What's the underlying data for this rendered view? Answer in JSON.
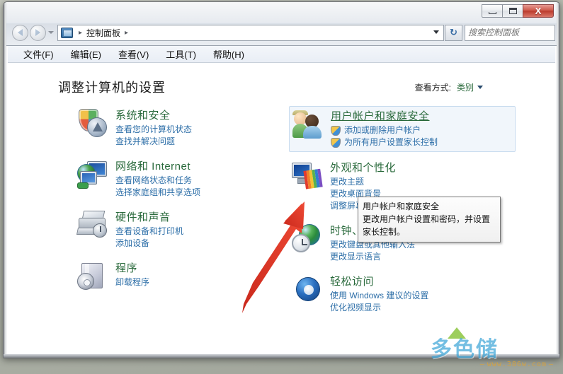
{
  "window": {
    "buttons": {
      "minimize": "—",
      "maximize": "□",
      "close": "X"
    }
  },
  "nav": {
    "back_icon": "back-arrow-icon",
    "forward_icon": "forward-arrow-icon",
    "recent_caret": "history-dropdown-icon",
    "breadcrumb_icon": "control-panel-icon",
    "breadcrumb": "控制面板",
    "breadcrumb_sep": "▸",
    "dropdown_caret": "▾",
    "refresh_label": "↻",
    "search_placeholder": "搜索控制面板"
  },
  "menubar": {
    "items": [
      {
        "label": "文件(F)"
      },
      {
        "label": "编辑(E)"
      },
      {
        "label": "查看(V)"
      },
      {
        "label": "工具(T)"
      },
      {
        "label": "帮助(H)"
      }
    ]
  },
  "page": {
    "title": "调整计算机的设置",
    "view_by_label": "查看方式:",
    "view_by_value": "类别"
  },
  "categories_left": [
    {
      "title": "系统和安全",
      "icon": "shield-gauge-icon",
      "links": [
        "查看您的计算机状态",
        "查找并解决问题"
      ]
    },
    {
      "title": "网络和 Internet",
      "icon": "network-globe-icon",
      "links": [
        "查看网络状态和任务",
        "选择家庭组和共享选项"
      ]
    },
    {
      "title": "硬件和声音",
      "icon": "printer-icon",
      "links": [
        "查看设备和打印机",
        "添加设备"
      ]
    },
    {
      "title": "程序",
      "icon": "program-box-icon",
      "links": [
        "卸载程序"
      ]
    }
  ],
  "categories_right": [
    {
      "title": "用户帐户和家庭安全",
      "icon": "users-icon",
      "selected": true,
      "links": [
        "添加或删除用户帐户",
        "为所有用户设置家长控制"
      ],
      "shielded": true
    },
    {
      "title": "外观和个性化",
      "icon": "appearance-palette-icon",
      "links": [
        "更改主题",
        "更改桌面背景",
        "调整屏幕分辨率"
      ]
    },
    {
      "title": "时钟、语言和区域",
      "icon": "clock-globe-icon",
      "links": [
        "更改键盘或其他输入法",
        "更改显示语言"
      ]
    },
    {
      "title": "轻松访问",
      "icon": "ease-of-access-icon",
      "links": [
        "使用 Windows 建议的设置",
        "优化视频显示"
      ]
    }
  ],
  "tooltip": {
    "title": "用户帐户和家庭安全",
    "body": "更改用户帐户设置和密码，并设置家长控制。"
  },
  "annotation": {
    "arrow_color": "#e03a29",
    "arrow_name": "red-pointer-arrow"
  },
  "watermark": {
    "logo_text": "多色储",
    "url": "www.386w.com"
  },
  "colors": {
    "category_title": "#2a6a3c",
    "link": "#2e6fa8",
    "close_button": "#bb3a2c",
    "selection_bg": "#f1f6fb"
  }
}
